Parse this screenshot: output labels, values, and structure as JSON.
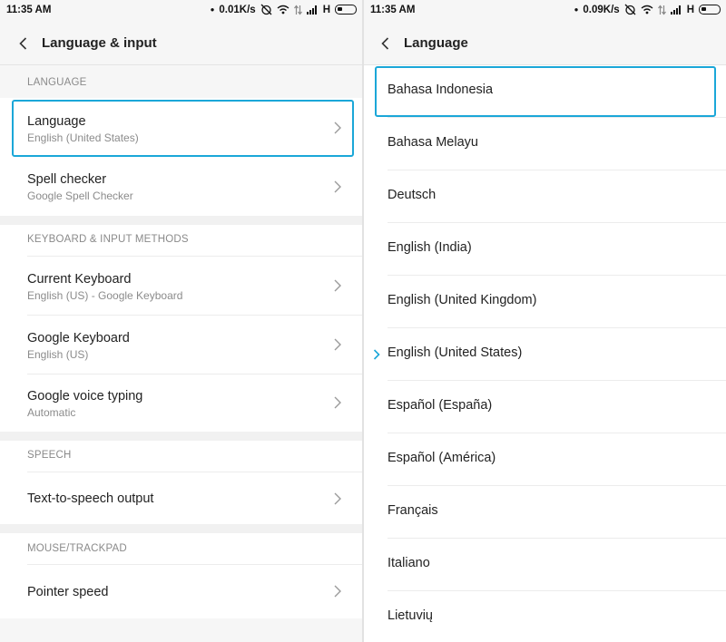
{
  "left": {
    "status": {
      "time": "11:35 AM",
      "speed": "0.01K/s",
      "network": "H"
    },
    "header": {
      "title": "Language & input"
    },
    "sections": [
      {
        "label": "LANGUAGE"
      },
      {
        "label": "KEYBOARD & INPUT METHODS"
      },
      {
        "label": "SPEECH"
      },
      {
        "label": "MOUSE/TRACKPAD"
      }
    ],
    "items": [
      {
        "title": "Language",
        "subtitle": "English (United States)"
      },
      {
        "title": "Spell checker",
        "subtitle": "Google Spell Checker"
      },
      {
        "title": "Current Keyboard",
        "subtitle": "English (US) - Google Keyboard"
      },
      {
        "title": "Google Keyboard",
        "subtitle": "English (US)"
      },
      {
        "title": "Google voice typing",
        "subtitle": "Automatic"
      },
      {
        "title": "Text-to-speech output"
      },
      {
        "title": "Pointer speed"
      }
    ]
  },
  "right": {
    "status": {
      "time": "11:35 AM",
      "speed": "0.09K/s",
      "network": "H"
    },
    "header": {
      "title": "Language"
    },
    "languages": [
      "Bahasa Indonesia",
      "Bahasa Melayu",
      "Deutsch",
      "English (India)",
      "English (United Kingdom)",
      "English (United States)",
      "Español (España)",
      "Español (América)",
      "Français",
      "Italiano",
      "Lietuvių"
    ],
    "selected_index": 5
  },
  "colors": {
    "accent": "#1ba7d8",
    "background": "#f6f6f6",
    "text": "#222222",
    "secondary_text": "#8b8b8b"
  }
}
